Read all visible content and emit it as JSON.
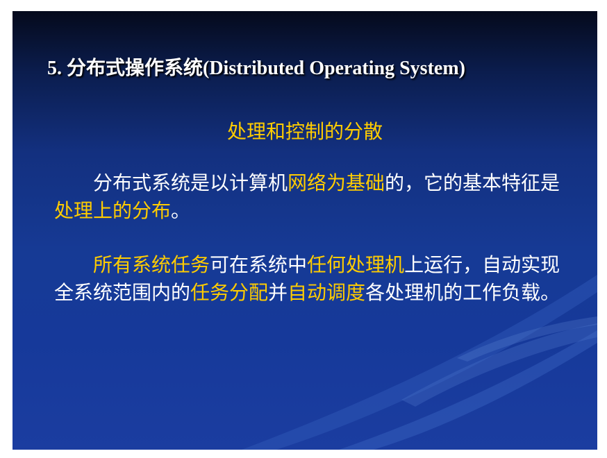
{
  "slide": {
    "title": "5. 分布式操作系统(Distributed Operating System)",
    "subtitle": "处理和控制的分散",
    "paragraph1": {
      "indent": "　　",
      "s1": "分布式系统是以计算机",
      "h1": "网络为基础",
      "s2": "的，它的基本特征是",
      "h2": "处理上的分布",
      "s3": "。"
    },
    "paragraph2": {
      "indent": "　　",
      "h1": "所有系统任务",
      "s1": "可在系统中",
      "h2": "任何处理机",
      "s2": "上运行，自动实现全系统范围内的",
      "h3": "任务分配",
      "s3": "并",
      "h4": "自动调度",
      "s4": "各处理机的工作负载。"
    }
  },
  "colors": {
    "background_top": "#050a1c",
    "background_main": "#16399a",
    "title_text": "#ffffff",
    "highlight_text": "#ffcc00",
    "body_text": "#ffffff"
  }
}
